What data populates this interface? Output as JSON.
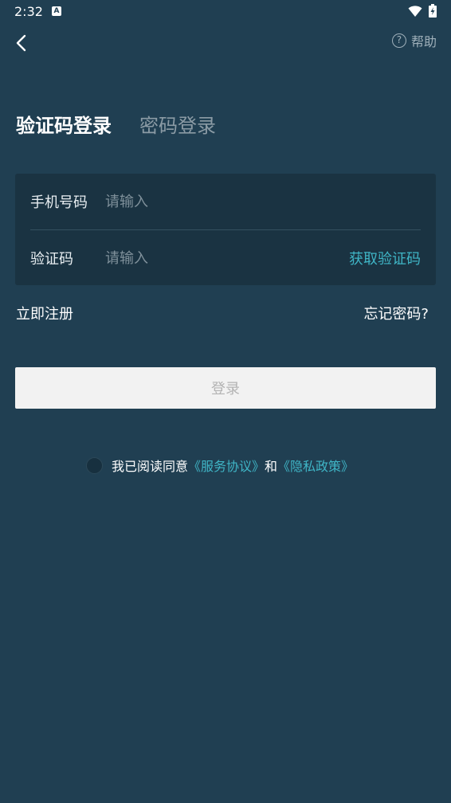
{
  "status_bar": {
    "time": "2:32",
    "a_icon": "A"
  },
  "header": {
    "back_icon": "chevron-left-icon",
    "help_label": "帮助",
    "help_icon": "?"
  },
  "tabs": [
    {
      "label": "验证码登录",
      "active": true
    },
    {
      "label": "密码登录",
      "active": false
    }
  ],
  "form": {
    "phone": {
      "label": "手机号码",
      "placeholder": "请输入",
      "value": ""
    },
    "code": {
      "label": "验证码",
      "placeholder": "请输入",
      "value": ""
    },
    "get_code_label": "获取验证码"
  },
  "links": {
    "register": "立即注册",
    "forgot": "忘记密码?"
  },
  "login_button": "登录",
  "agreement": {
    "checked": false,
    "prefix": "我已阅读同意",
    "service_link": "《服务协议》",
    "conjunction": "和",
    "privacy_link": "《隐私政策》"
  },
  "colors": {
    "background": "#203f52",
    "card": "#1a3342",
    "accent": "#3fb5c6",
    "button_bg": "#f2f2f2",
    "button_text": "#b3b3b3"
  }
}
